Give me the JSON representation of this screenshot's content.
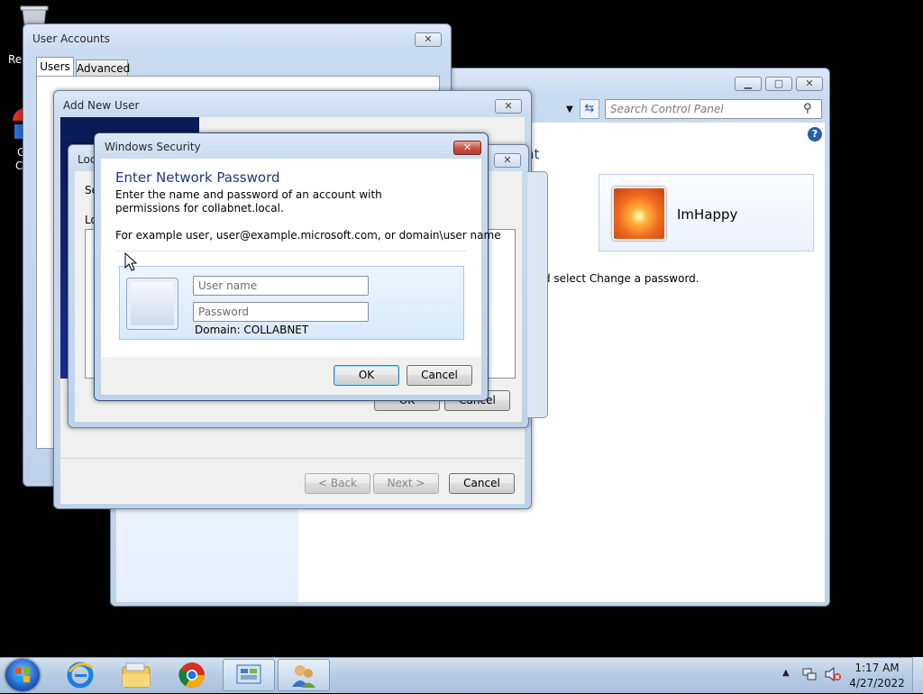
{
  "desktop": {
    "recycle_label": "Rec",
    "chrome_label_1": "G",
    "chrome_label_2": "C"
  },
  "user_accounts_window": {
    "title": "User Accounts",
    "tabs": [
      "Users",
      "Advanced"
    ]
  },
  "control_panel_window": {
    "search_placeholder": "Search Control Panel",
    "heading_fragment": "nt",
    "account_name": "ImHappy",
    "instruction_fragment": "d select Change a password."
  },
  "add_user_window": {
    "title": "Add New User",
    "back": "< Back",
    "next": "Next >",
    "cancel": "Cancel"
  },
  "local_dialog": {
    "title_fragment": "Loc",
    "label_fragment": "Se",
    "list_label": "Lo",
    "ok_fragment": "OK",
    "cancel_fragment": "Cancel"
  },
  "security_dialog": {
    "title": "Windows Security",
    "heading": "Enter Network Password",
    "description": "Enter the name and password of an account with permissions for collabnet.local.",
    "example": "For example user, user@example.microsoft.com, or domain\\user name",
    "username_placeholder": "User name",
    "password_placeholder": "Password",
    "domain": "Domain: COLLABNET",
    "ok": "OK",
    "cancel": "Cancel"
  },
  "taskbar": {
    "time": "1:17 AM",
    "date": "4/27/2022"
  },
  "colors": {
    "taskbar": "#b9cde4",
    "security_panel": "#dfeefc",
    "accent_blue": "#1f4e8c"
  }
}
